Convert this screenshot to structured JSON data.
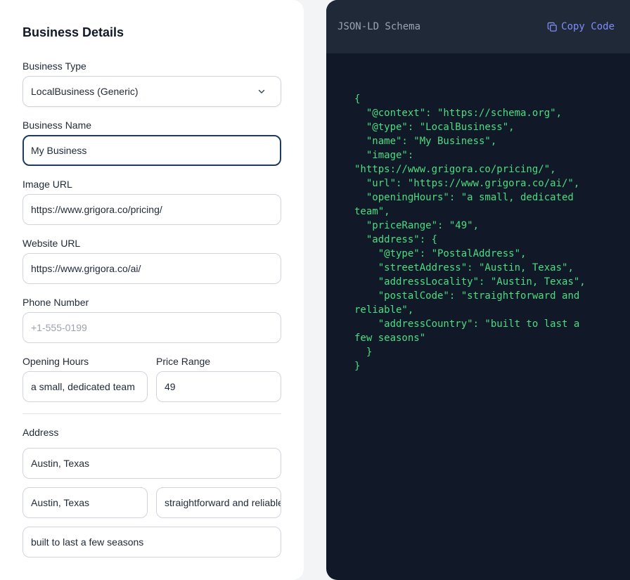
{
  "form": {
    "title": "Business Details",
    "business_type": {
      "label": "Business Type",
      "value": "LocalBusiness (Generic)"
    },
    "business_name": {
      "label": "Business Name",
      "value": "My Business"
    },
    "image_url": {
      "label": "Image URL",
      "value": "https://www.grigora.co/pricing/"
    },
    "website_url": {
      "label": "Website URL",
      "value": "https://www.grigora.co/ai/"
    },
    "phone": {
      "label": "Phone Number",
      "placeholder": "+1-555-0199"
    },
    "opening_hours": {
      "label": "Opening Hours",
      "value": "a small, dedicated team"
    },
    "price_range": {
      "label": "Price Range",
      "value": "49"
    },
    "address": {
      "label": "Address",
      "street": "Austin, Texas",
      "locality": "Austin, Texas",
      "postal": "straightforward and reliable",
      "country": "built to last a few seasons"
    }
  },
  "code_panel": {
    "title": "JSON-LD Schema",
    "copy_label": "Copy Code",
    "code": "{\n  \"@context\": \"https://schema.org\",\n  \"@type\": \"LocalBusiness\",\n  \"name\": \"My Business\",\n  \"image\":\n\"https://www.grigora.co/pricing/\",\n  \"url\": \"https://www.grigora.co/ai/\",\n  \"openingHours\": \"a small, dedicated\nteam\",\n  \"priceRange\": \"49\",\n  \"address\": {\n    \"@type\": \"PostalAddress\",\n    \"streetAddress\": \"Austin, Texas\",\n    \"addressLocality\": \"Austin, Texas\",\n    \"postalCode\": \"straightforward and\nreliable\",\n    \"addressCountry\": \"built to last a\nfew seasons\"\n  }\n}"
  },
  "colors": {
    "accent": "#818cf8",
    "code_text": "#4ade80",
    "code_bg": "#111827",
    "focus_border": "#1e3a5f"
  },
  "icons": [
    "chevron-down-icon",
    "copy-icon"
  ]
}
